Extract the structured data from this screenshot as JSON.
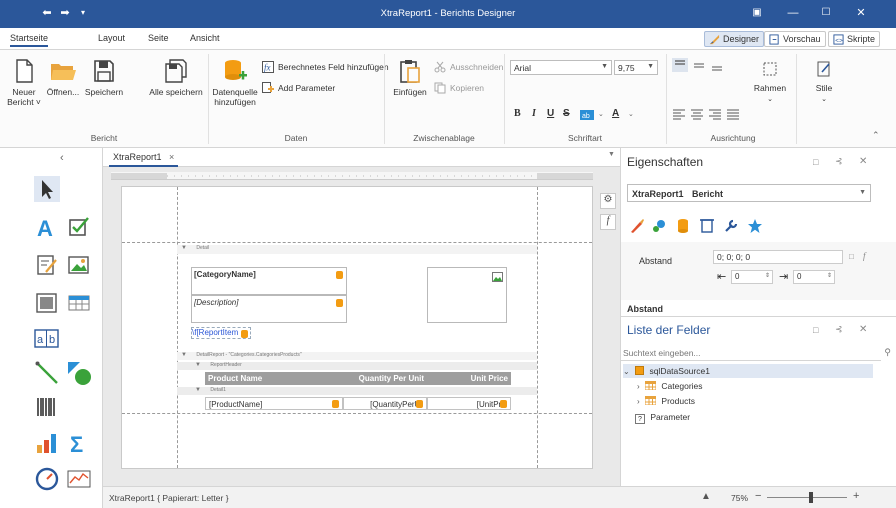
{
  "window": {
    "title": "XtraReport1 - Berichts Designer"
  },
  "ribbon_tabs": [
    "Startseite",
    "Layout",
    "Seite",
    "Ansicht"
  ],
  "view_tabs": {
    "designer": "Designer",
    "vorschau": "Vorschau",
    "skripte": "Skripte"
  },
  "groups": {
    "bericht": {
      "label": "Bericht",
      "neuer": "Neuer",
      "neuer2": "Bericht ˅",
      "oeffnen": "Öffnen...",
      "speichern": "Speichern",
      "alle": "Alle speichern"
    },
    "daten": {
      "label": "Daten",
      "quelle1": "Datenquelle",
      "quelle2": "hinzufügen",
      "berechnet": "Berechnetes Feld hinzufügen",
      "parameter": "Add Parameter"
    },
    "zwischenablage": {
      "label": "Zwischenablage",
      "einfuegen": "Einfügen",
      "ausschneiden": "Ausschneiden",
      "kopieren": "Kopieren"
    },
    "schriftart": {
      "label": "Schriftart",
      "font": "Arial",
      "size": "9,75"
    },
    "ausrichtung": {
      "label": "Ausrichtung"
    },
    "rahmen": "Rahmen",
    "stile": "Stile"
  },
  "document": {
    "tab": "XtraReport1",
    "status": "XtraReport1 { Papierart: Letter }",
    "zoom": "75%",
    "zoom_level": 0.55
  },
  "report": {
    "band_detail": "Detail",
    "band_detailreport": "DetailReport - \"Categories.CategoriesProducts\"",
    "band_reportheader": "ReportHeader",
    "band_detail1": "Detail1",
    "category": "[CategoryName]",
    "description": "[Description]",
    "reportitem": "\\f[ReportItem",
    "headers": [
      "Product Name",
      "Quantity Per Unit",
      "Unit Price"
    ],
    "cells": [
      "[ProductName]",
      "[QuantityPerUr",
      "[UnitPric"
    ]
  },
  "properties": {
    "header": "Eigenschaften",
    "object": "XtraReport1",
    "object_type": "Bericht",
    "abstand_label": "Abstand",
    "abstand_value": "0; 0; 0; 0",
    "left_value": "0",
    "right_value": "0",
    "section": "Abstand"
  },
  "fieldlist": {
    "header": "Liste der Felder",
    "search_placeholder": "Suchtext eingeben...",
    "source": "sqlDataSource1",
    "categories": "Categories",
    "products": "Products",
    "parameter": "Parameter"
  }
}
